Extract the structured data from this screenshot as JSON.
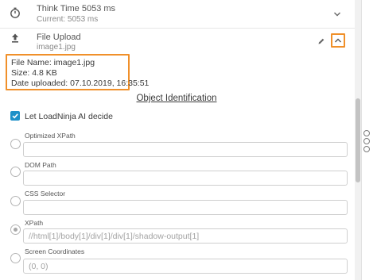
{
  "steps": {
    "think_time": {
      "title": "Think Time 5053 ms",
      "subtitle": "Current: 5053 ms",
      "icon": "timer-icon"
    },
    "file_upload": {
      "title": "File Upload",
      "subtitle": "image1.jpg",
      "icon": "upload-icon"
    }
  },
  "file_info": {
    "name_line": "File Name: image1.jpg",
    "size_line": "Size: 4.8 KB",
    "date_line": "Date uploaded: 07.10.2019, 16:35:51"
  },
  "object_identification": {
    "title": "Object Identification",
    "ai_checkbox_label": "Let LoadNinja AI decide",
    "ai_checked": true,
    "fields": [
      {
        "label": "Optimized XPath",
        "value": "",
        "placeholder": "",
        "selected": false
      },
      {
        "label": "DOM Path",
        "value": "",
        "placeholder": "",
        "selected": false
      },
      {
        "label": "CSS Selector",
        "value": "",
        "placeholder": "",
        "selected": false
      },
      {
        "label": "XPath",
        "value": "",
        "placeholder": "//html[1]/body[1]/div[1]/div[1]/shadow-output[1]",
        "selected": true
      },
      {
        "label": "Screen Coordinates",
        "value": "",
        "placeholder": "(0, 0)",
        "selected": false
      }
    ]
  },
  "colors": {
    "highlight": "#f0902a",
    "checkbox": "#1e90c8"
  }
}
